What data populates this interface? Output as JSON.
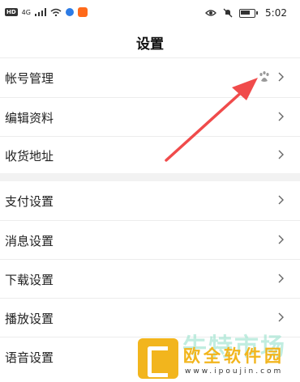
{
  "status_bar": {
    "time": "5:02",
    "network": "4G"
  },
  "header": {
    "title": "设置"
  },
  "settings": {
    "account": "帐号管理",
    "edit_profile": "编辑资料",
    "shipping_address": "收货地址",
    "payment": "支付设置",
    "notifications": "消息设置",
    "download": "下载设置",
    "playback": "播放设置",
    "voice": "语音设置"
  },
  "watermark": {
    "faint_text": "牛特市场",
    "brand": "欧全软件园",
    "domain": "www.ipoujin.com"
  },
  "colors": {
    "accent_arrow": "#f04b4b",
    "section_gap": "#f2f2f2"
  }
}
